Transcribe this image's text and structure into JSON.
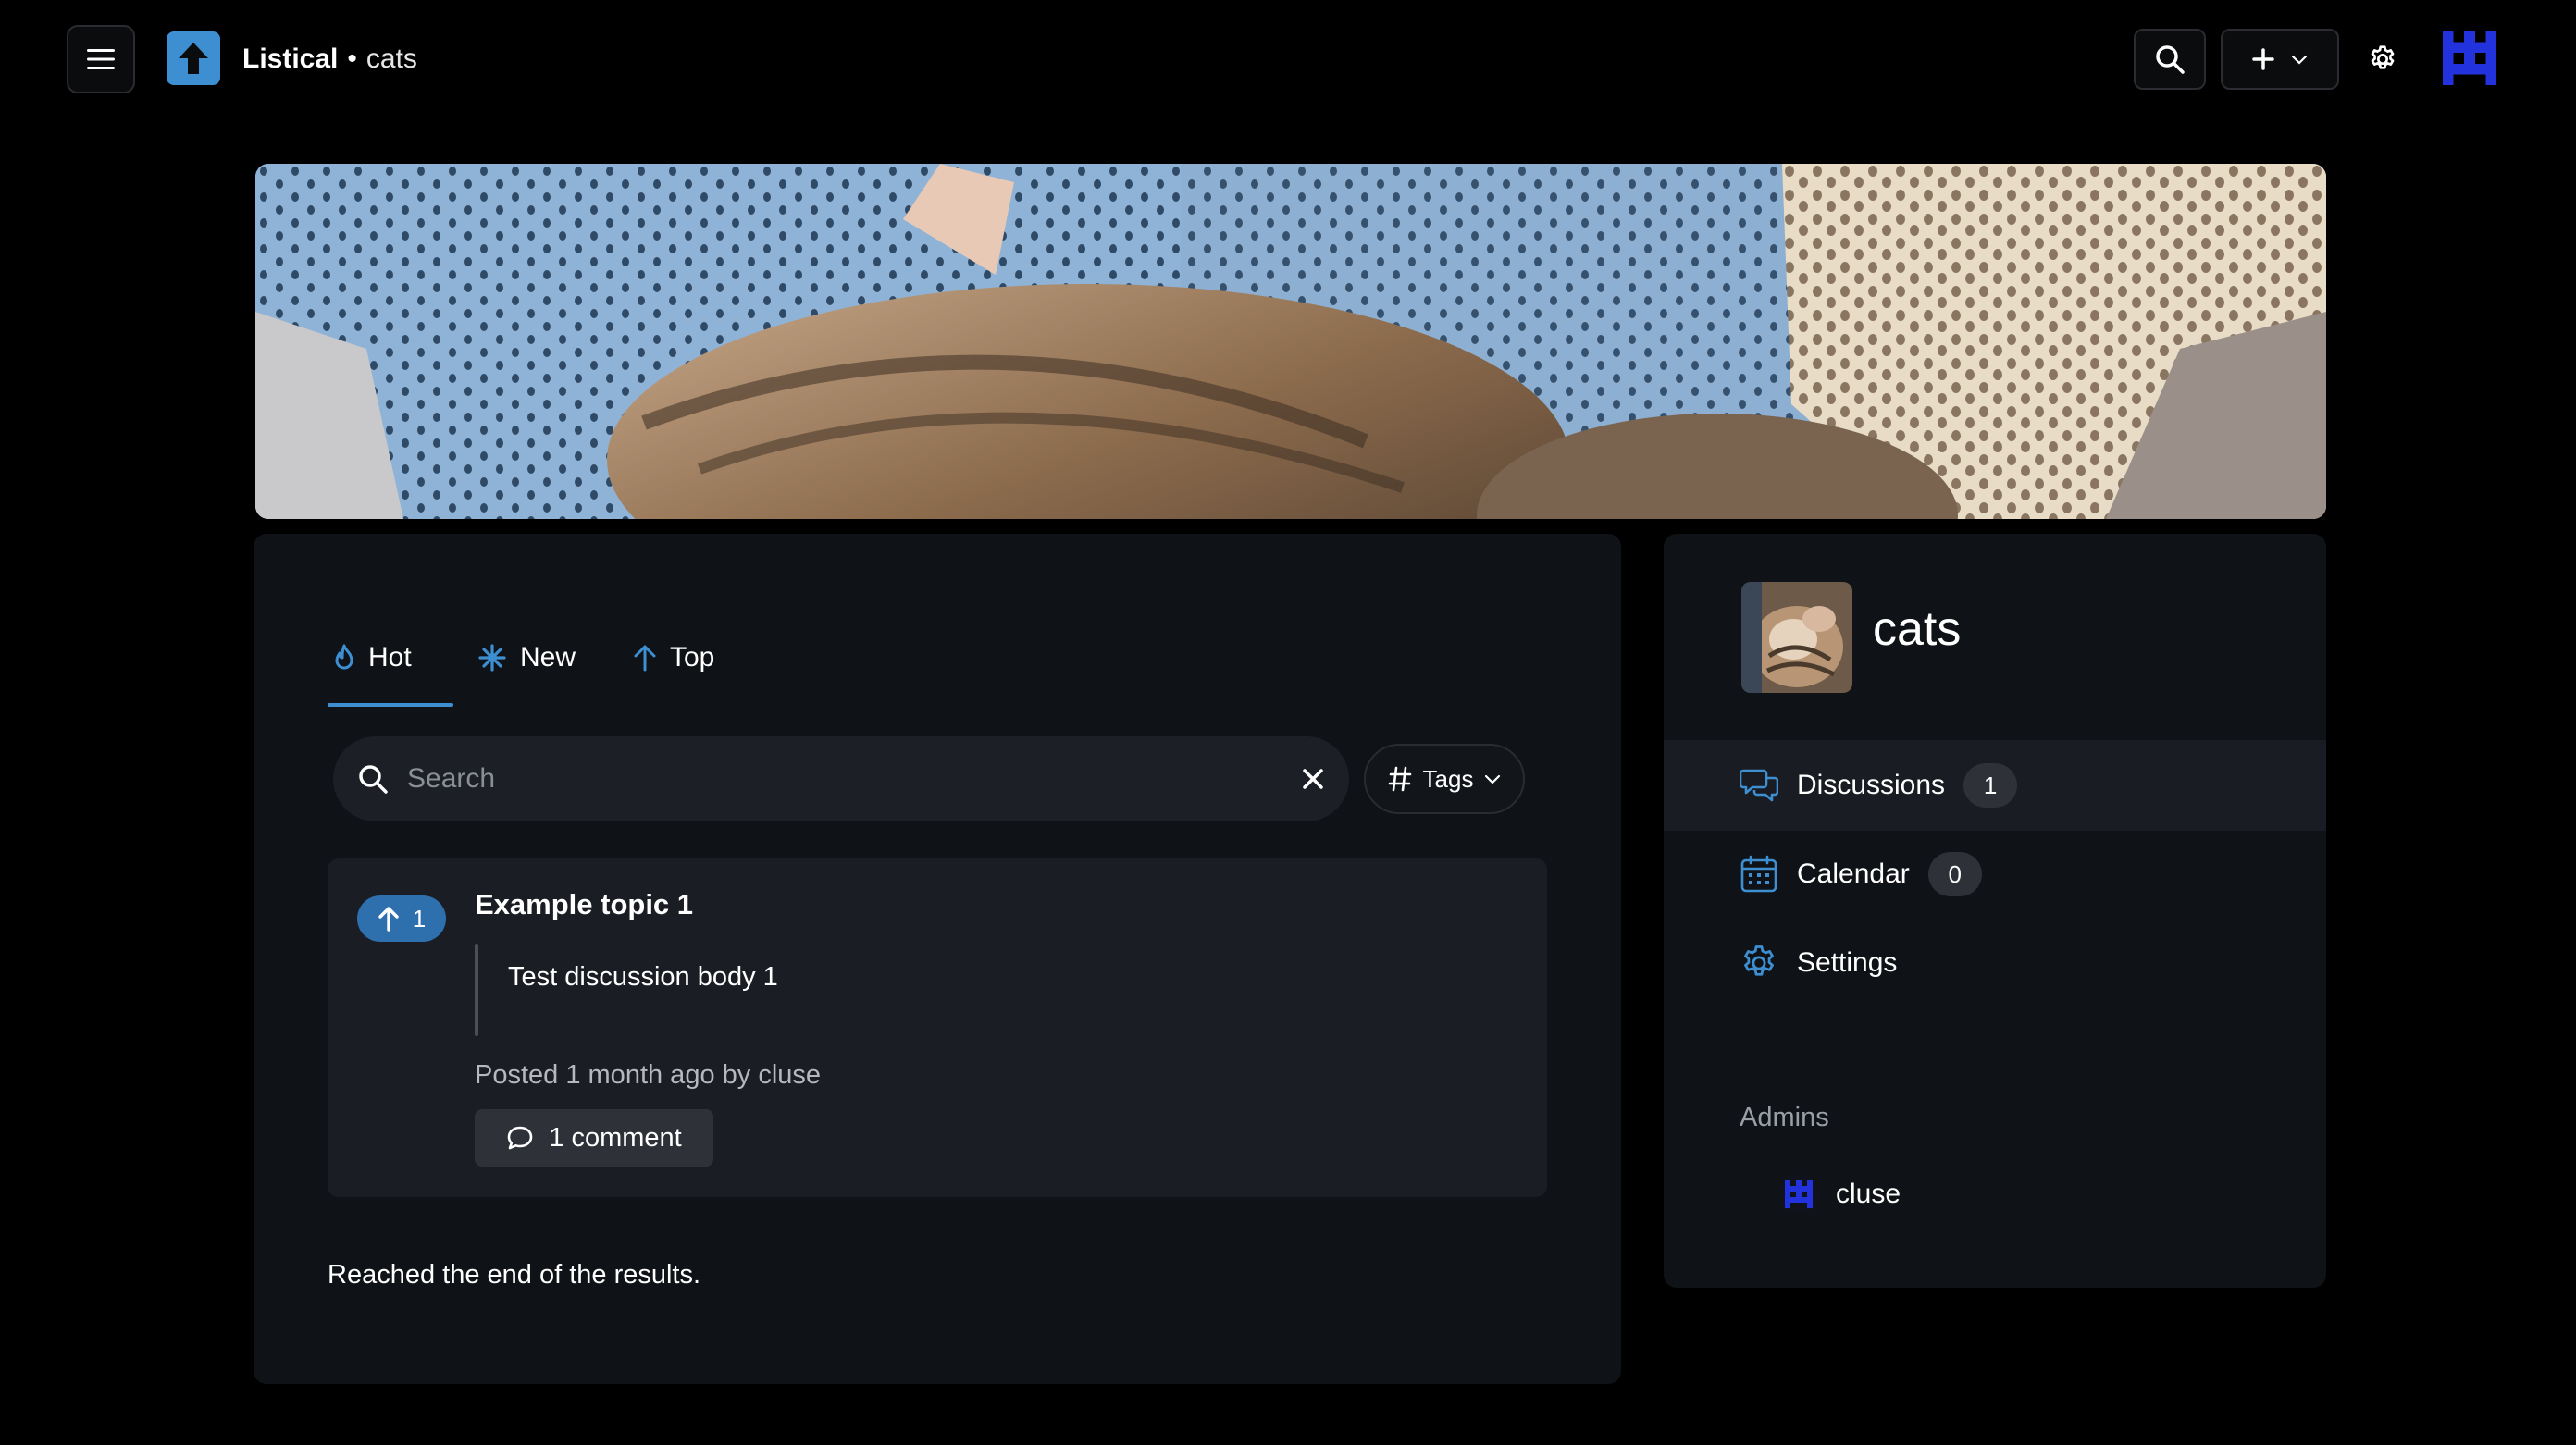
{
  "header": {
    "app_name": "Listical",
    "separator": "•",
    "community": "cats"
  },
  "tabs": [
    {
      "label": "Hot",
      "active": true
    },
    {
      "label": "New"
    },
    {
      "label": "Top"
    }
  ],
  "search": {
    "placeholder": "Search",
    "value": ""
  },
  "tags_label": "Tags",
  "post": {
    "votes": "1",
    "title": "Example topic 1",
    "body": "Test discussion body 1",
    "meta": "Posted 1 month ago by cluse",
    "comments_label": "1 comment"
  },
  "end_text": "Reached the end of the results.",
  "sidebar": {
    "community_name": "cats",
    "items": [
      {
        "label": "Discussions",
        "count": "1"
      },
      {
        "label": "Calendar",
        "count": "0"
      },
      {
        "label": "Settings"
      }
    ],
    "admins_label": "Admins",
    "admins": [
      {
        "name": "cluse"
      }
    ]
  },
  "colors": {
    "accent": "#3d8fd1",
    "vote_pill": "#2e6fae",
    "avatar_blue": "#2233dd",
    "background": "#000000",
    "panel": "#0f1216"
  },
  "icons": {
    "menu": "hamburger-icon",
    "logo": "arrow-up-icon",
    "search": "search-icon",
    "create": "plus-icon",
    "settings": "gear-icon",
    "hot": "flame-icon",
    "new": "sparkle-icon",
    "top": "arrow-up-icon",
    "clear": "close-icon",
    "tags": "hash-icon",
    "comment": "comment-icon",
    "discussions": "chat-bubbles-icon",
    "calendar": "calendar-icon"
  }
}
